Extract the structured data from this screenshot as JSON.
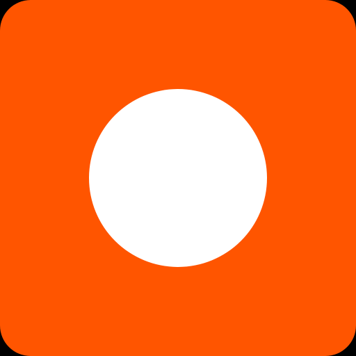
{
  "icon": {
    "name": "record-icon",
    "colors": {
      "background": "#000000",
      "tile": "#FF5500",
      "dot": "#FFFFFF"
    }
  }
}
